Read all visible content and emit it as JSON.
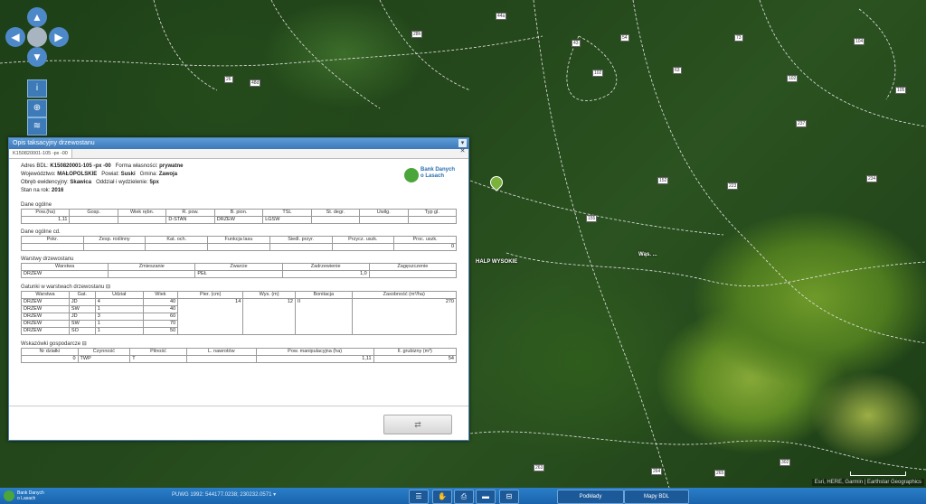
{
  "map": {
    "place_label_1": "HALP WYSOKIE",
    "place_label_2": "Wąs. ...",
    "parcel_labels": [
      "26",
      "48d",
      "28h",
      "44a",
      "43",
      "54",
      "63",
      "73",
      "102",
      "102",
      "104",
      "105",
      "152",
      "155",
      "223",
      "234",
      "237",
      "263",
      "264",
      "265",
      "302"
    ],
    "attribution": "Esri, HERE, Garmin | Earthstar Geographics"
  },
  "nav": {
    "up": "▲",
    "down": "▼",
    "left": "◀",
    "right": "▶",
    "tools": [
      "i",
      "⊕",
      "≋"
    ]
  },
  "dialog": {
    "title": "Opis taksacyjny drzewostanu",
    "close": "▾ ✕",
    "tab": "K150820001-105 -px -00",
    "header": {
      "adres_label": "Adres BDL:",
      "adres_value": "K150820001-105 -px -00",
      "forma_label": "Forma własności:",
      "forma_value": "prywatne",
      "woj_label": "Województwo:",
      "woj_value": "MAŁOPOLSKIE",
      "powiat_label": "Powiat:",
      "powiat_value": "Suski",
      "gmina_label": "Gmina:",
      "gmina_value": "Zawoja",
      "obreb_label": "Obręb ewidencyjny:",
      "obreb_value": "Skawica",
      "oddzial_label": "Oddział i wydzielenie:",
      "oddzial_value": "5px",
      "stan_label": "Stan na rok:",
      "stan_value": "2016"
    },
    "logo_text_1": "Bank Danych",
    "logo_text_2": "o Lasach",
    "dane_ogolne": {
      "title": "Dane ogólne",
      "headers": [
        "Pow.(ha)",
        "Gosp.",
        "Wiek rębn.",
        "R. pow.",
        "B. pion.",
        "TSL",
        "St. degr.",
        "Uwilg.",
        "Typ gl."
      ],
      "row": [
        "1,11",
        "",
        "",
        "D-STAN",
        "DRZEW",
        "LGŚW",
        "",
        "",
        ""
      ]
    },
    "dane_ogolne_cd": {
      "title": "Dane ogólne cd.",
      "headers": [
        "Pokr.",
        "Zesp. roślinny",
        "Kat. och.",
        "Funkcja lasu",
        "Siedl. przyr.",
        "Przycz. uszk.",
        "Proc. uszk."
      ],
      "row": [
        "",
        "",
        "",
        "",
        "",
        "",
        "0"
      ]
    },
    "warstwy": {
      "title": "Warstwy drzewostanu",
      "headers": [
        "Warstwa",
        "Zmieszanie",
        "Zwarcie",
        "Zadrzewienie",
        "Zagęszczenie"
      ],
      "row": [
        "DRZEW",
        "",
        "PEŁ",
        "1,0",
        ""
      ]
    },
    "gatunki": {
      "title": "Gatunki w warstwach drzewostanu",
      "headers": [
        "Warstwa",
        "Gat.",
        "Udział",
        "Wiek",
        "Pier. (cm)",
        "Wys. (m)",
        "Bonitacja",
        "Zasobność (m³/ha)"
      ],
      "rows": [
        [
          "DRZEW",
          "JD",
          "4",
          "40"
        ],
        [
          "DRZEW",
          "ŚW",
          "1",
          "40"
        ],
        [
          "DRZEW",
          "JD",
          "3",
          "60"
        ],
        [
          "DRZEW",
          "ŚW",
          "1",
          "70"
        ],
        [
          "DRZEW",
          "SO",
          "1",
          "50"
        ]
      ],
      "pier": "14",
      "wys": "12",
      "bonitacja": "II",
      "zasobnosc": "270"
    },
    "wskazowki": {
      "title": "Wskazówki gospodarcze",
      "headers": [
        "Nr działki",
        "Czynność",
        "Pilność",
        "L. nawrotów",
        "Pow. manipulacyjna (ha)",
        "Il. grubizny (m³)"
      ],
      "row": [
        "0",
        "TWP",
        "T",
        "",
        "1,11",
        "54"
      ]
    },
    "button_icon": "⇄"
  },
  "statusbar": {
    "logo_1": "Bank Danych",
    "logo_2": "o Lasach",
    "coords": "PUWG 1992: 544177.0238; 230232.0571 ▾",
    "icons": [
      "☰",
      "✋",
      "⎙",
      "▬",
      "⊟"
    ],
    "podklady": "Podkłady",
    "mapy": "Mapy BDL"
  }
}
